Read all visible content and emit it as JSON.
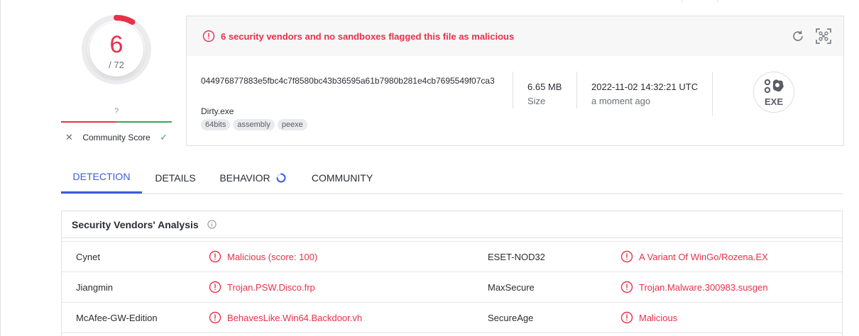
{
  "score": {
    "detections": "6",
    "total": "/ 72",
    "community_value": "?",
    "community_label": "Community Score",
    "downvote_icon": "✕",
    "upvote_icon": "✓",
    "ring_fraction": 0.0833,
    "colors": {
      "malicious": "#e8304a",
      "harmless": "#3aa357"
    }
  },
  "file": {
    "alert": "6 security vendors and no sandboxes flagged this file as malicious",
    "hash": "044976877883e5fbc4c7f8580bc43b36595a61b7980b281e4cb7695549f07ca3",
    "name": "Dirty.exe",
    "tags": [
      "64bits",
      "assembly",
      "peexe"
    ],
    "size_value": "6.65 MB",
    "size_label": "Size",
    "date_value": "2022-11-02 14:32:21 UTC",
    "date_label": "a moment ago",
    "type_badge": "EXE"
  },
  "tabs": {
    "detection": "DETECTION",
    "details": "DETAILS",
    "behavior": "BEHAVIOR",
    "community": "COMMUNITY"
  },
  "analysis": {
    "title": "Security Vendors' Analysis",
    "rows": [
      {
        "vendor1": "Cynet",
        "result1": "Malicious (score: 100)",
        "vendor2": "ESET-NOD32",
        "result2": "A Variant Of WinGo/Rozena.EX"
      },
      {
        "vendor1": "Jiangmin",
        "result1": "Trojan.PSW.Disco.frp",
        "vendor2": "MaxSecure",
        "result2": "Trojan.Malware.300983.susgen"
      },
      {
        "vendor1": "McAfee-GW-Edition",
        "result1": "BehavesLike.Win64.Backdoor.vh",
        "vendor2": "SecureAge",
        "result2": "Malicious"
      }
    ]
  }
}
